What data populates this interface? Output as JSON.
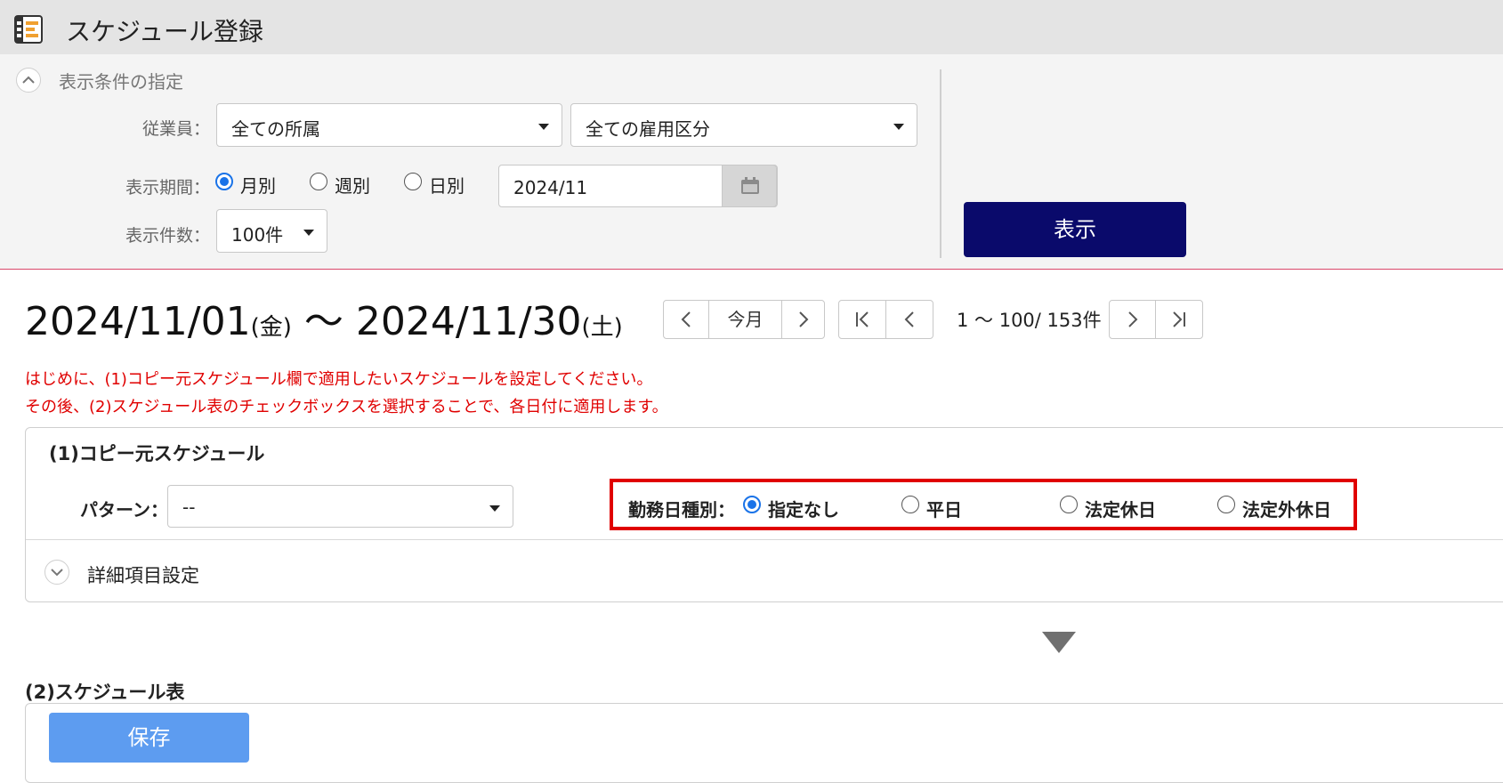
{
  "header": {
    "title": "スケジュール登録",
    "icon": "schedule-list-icon"
  },
  "conditions": {
    "section_title": "表示条件の指定",
    "employee_label": "従業員：",
    "department_select": "全ての所属",
    "employment_select": "全ての雇用区分",
    "period_label": "表示期間：",
    "period_options": [
      "月別",
      "週別",
      "日別"
    ],
    "period_selected": "月別",
    "period_value": "2024/11",
    "count_label": "表示件数：",
    "count_select": "100件",
    "show_button": "表示"
  },
  "range": {
    "start": "2024/11/01",
    "start_day": "(金)",
    "tilde": "～",
    "end": "2024/11/30",
    "end_day": "(土)"
  },
  "pager": {
    "this_month": "今月",
    "page_info": "1 ～ 100/ 153件"
  },
  "notes": [
    "はじめに、(1)コピー元スケジュール欄で適用したいスケジュールを設定してください。",
    "その後、(2)スケジュール表のチェックボックスを選択することで、各日付に適用します。"
  ],
  "copy_source": {
    "title": "(1)コピー元スケジュール",
    "pattern_label": "パターン：",
    "pattern_value": "--",
    "workday_label": "勤務日種別：",
    "workday_options": [
      "指定なし",
      "平日",
      "法定休日",
      "法定外休日"
    ],
    "workday_selected": "指定なし",
    "detail_label": "詳細項目設定",
    "highlight_color": "#e00000"
  },
  "schedule_table": {
    "title": "(2)スケジュール表",
    "save_button": "保存"
  },
  "colors": {
    "primary_button": "#0a0a6b",
    "save_button": "#5d9cf0",
    "note_text": "#e00000",
    "radio_checked": "#1a73e8"
  }
}
